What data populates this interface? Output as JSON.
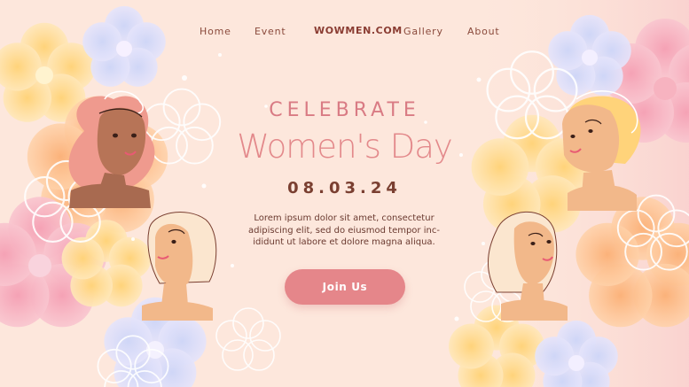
{
  "nav": {
    "items": [
      "Home",
      "Event",
      "Gallery",
      "About"
    ],
    "brand": "WOWMEN.COM"
  },
  "hero": {
    "eyebrow": "CELEBRATE",
    "title": "Women's Day",
    "date": "08.03.24",
    "blurb_lines": [
      "Lorem ipsum dolor sit amet, consectetur",
      "adipiscing elit, sed do eiusmod tempor inc-",
      "ididunt ut labore et dolore magna aliqua."
    ],
    "cta": "Join Us"
  },
  "colors": {
    "background": "#fde7dc",
    "accent": "#e5868a",
    "headline": "#d97b84",
    "text_dark": "#7a3f31"
  },
  "illustrations": [
    "portrait-curly-hair-icon",
    "portrait-short-blonde-icon",
    "portrait-wavy-hair-icon",
    "portrait-bob-hair-icon",
    "flower-icon"
  ]
}
